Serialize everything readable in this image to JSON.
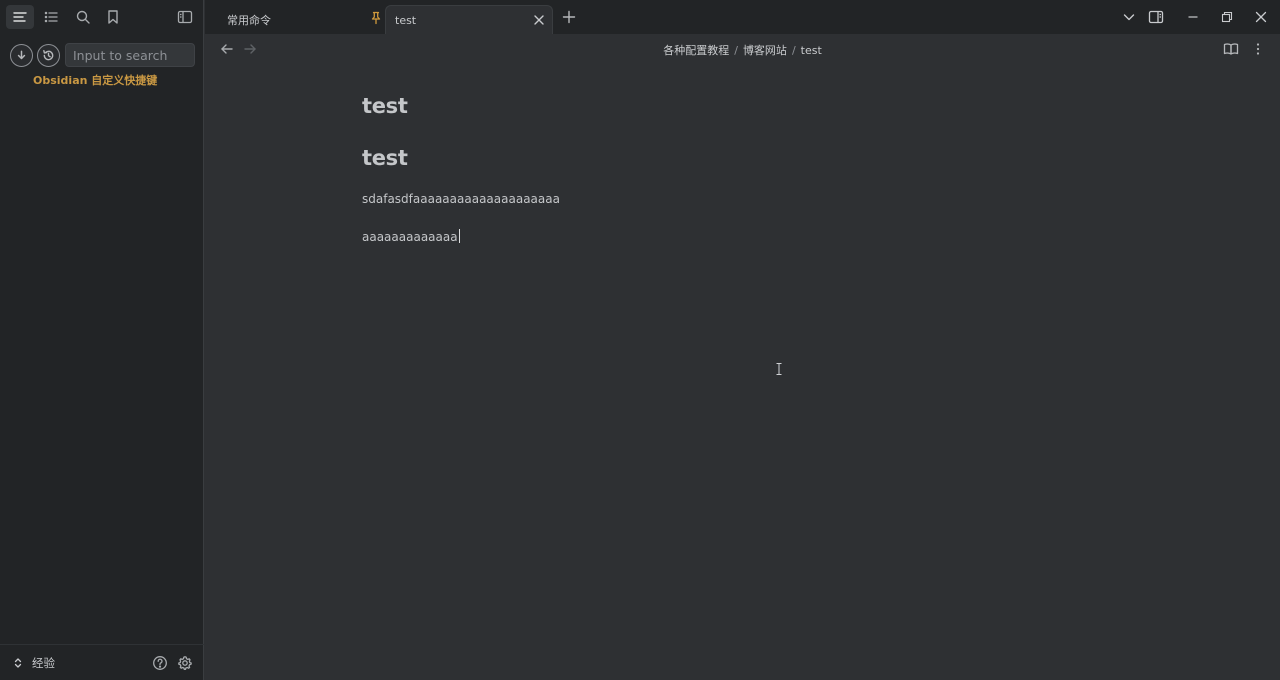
{
  "sidebar": {
    "search_placeholder": "Input to search",
    "search_value": "",
    "result_label": "Obsidian 自定义快捷键",
    "vault_name": "经验"
  },
  "tabs": [
    {
      "label": "常用命令",
      "pinned": true,
      "active": false
    },
    {
      "label": "test",
      "pinned": false,
      "active": true
    }
  ],
  "breadcrumb": [
    "各种配置教程",
    "博客网站",
    "test"
  ],
  "editor": {
    "heading1": "test",
    "heading2": "test",
    "para1": "sdafasdfaaaaaaaaaaaaaaaaaaaa",
    "para2": "aaaaaaaaaaaaa"
  },
  "colors": {
    "background": "#2e3033",
    "sidebar": "#222426",
    "accent": "#c99843"
  }
}
